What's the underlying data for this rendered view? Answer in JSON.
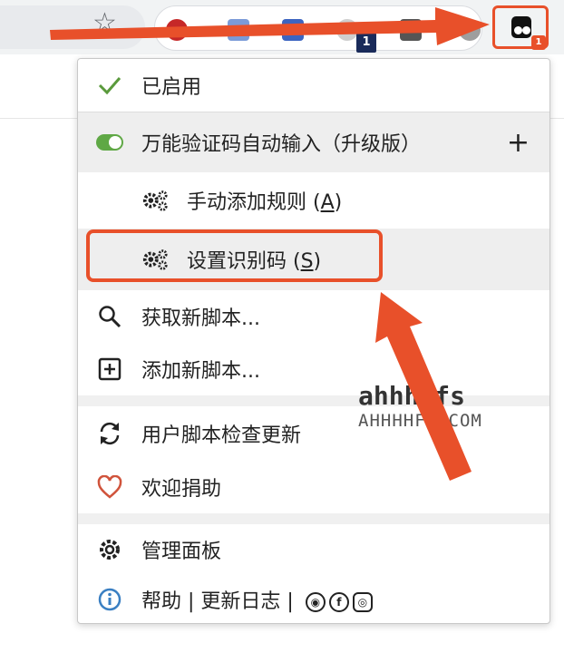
{
  "toolbar": {
    "extension_badge": "1",
    "tm_badge": "1"
  },
  "menu": {
    "enabled_label": "已启用",
    "script_name": "万能验证码自动输入（升级版）",
    "add_rule_label": "手动添加规则 (",
    "add_rule_key": "A",
    "set_code_label": "设置识别码 (",
    "set_code_key": "S",
    "close_paren": ")",
    "get_scripts_label": "获取新脚本...",
    "new_script_label": "添加新脚本...",
    "check_updates_label": "用户脚本检查更新",
    "donate_label": "欢迎捐助",
    "dashboard_label": "管理面板",
    "help_label": "帮助 | 更新日志 |",
    "plus_symbol": "+"
  },
  "watermark": {
    "line1": "ahhhhfs",
    "line2": "AHHHHFS.COM"
  },
  "colors": {
    "accent": "#e8502a",
    "toggle_on": "#5fa845",
    "check": "#5a9a3c",
    "heart": "#d0533b",
    "info": "#3a7fc2"
  },
  "icons": [
    "star-icon",
    "check-icon",
    "toggle-icon",
    "gear-icon",
    "search-icon",
    "plus-square-icon",
    "refresh-icon",
    "heart-icon",
    "settings-icon",
    "info-icon",
    "github-icon",
    "facebook-icon",
    "instagram-icon"
  ]
}
